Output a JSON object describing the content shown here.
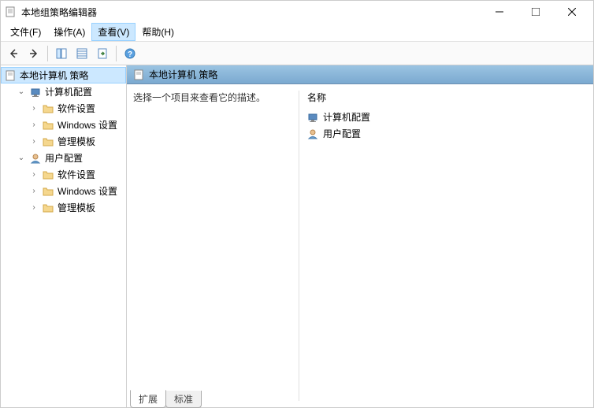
{
  "window": {
    "title": "本地组策略编辑器"
  },
  "menu": {
    "file": "文件(F)",
    "action": "操作(A)",
    "view": "查看(V)",
    "help": "帮助(H)"
  },
  "tree": {
    "root": "本地计算机 策略",
    "computer": "计算机配置",
    "user": "用户配置",
    "software": "软件设置",
    "windows": "Windows 设置",
    "admin": "管理模板"
  },
  "content": {
    "header": "本地计算机 策略",
    "description": "选择一个项目来查看它的描述。",
    "column_name": "名称",
    "items": {
      "computer": "计算机配置",
      "user": "用户配置"
    }
  },
  "tabs": {
    "extended": "扩展",
    "standard": "标准"
  }
}
